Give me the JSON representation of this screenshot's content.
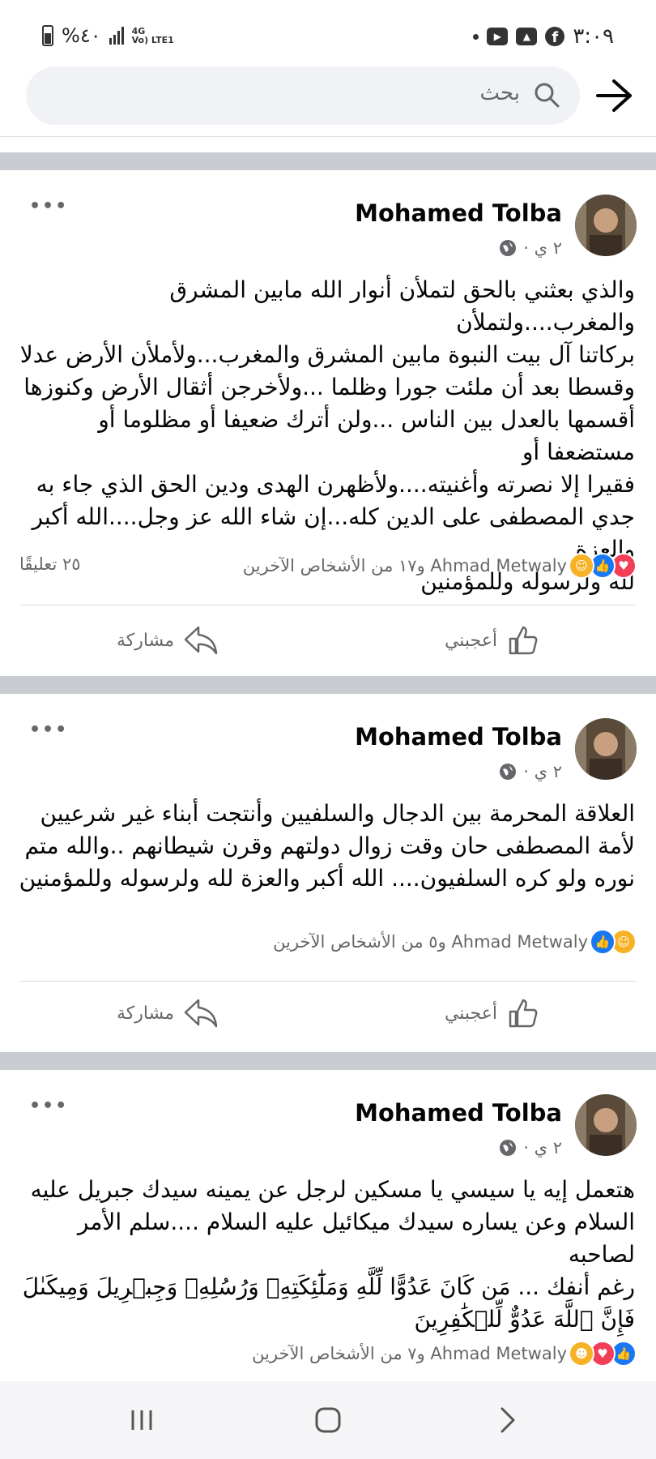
{
  "status_bar": {
    "time": "٣:٠٩",
    "battery": "%٤٠",
    "network_top": "4G",
    "network_bottom": "Vo) LTE1"
  },
  "search": {
    "placeholder": "بحث"
  },
  "posts": [
    {
      "author": "Mohamed Tolba",
      "time": "٢ ي ·",
      "text": "والذي بعثني بالحق لتملأن أنوار الله مابين المشرق والمغرب....ولتملأن\nبركاتنا آل بيت النبوة مابين المشرق والمغرب...ولأملأن الأرض عدلا\nوقسطا بعد أن ملئت جورا وظلما ...ولأخرجن أثقال الأرض وكنوزها\nأقسمها بالعدل بين الناس ...ولن أترك ضعيفا أو مظلوما أو مستضعفا أو\nفقيرا إلا نصرته وأغنيته....ولأظهرن الهدى ودين الحق الذي جاء به\nجدي المصطفى على الدين كله...إن شاء الله عز وجل....الله أكبر والعزة\nلله ولرسوله وللمؤمنين",
      "reactions_text": "Ahmad Metwaly و١٧ من الأشخاص الآخرين",
      "comments": "٢٥ تعليقًا",
      "like_label": "أعجبني",
      "share_label": "مشاركة"
    },
    {
      "author": "Mohamed Tolba",
      "time": "٢ ي ·",
      "text": "العلاقة المحرمة بين الدجال والسلفيين وأنتجت أبناء غير شرعيين\nلأمة المصطفى حان وقت زوال دولتهم وقرن شيطانهم ..والله متم\nنوره ولو كره السلفيون....  الله أكبر والعزة لله ولرسوله وللمؤمنين",
      "reactions_text": "Ahmad Metwaly و٥ من الأشخاص الآخرين",
      "like_label": "أعجبني",
      "share_label": "مشاركة"
    },
    {
      "author": "Mohamed Tolba",
      "time": "٢ ي ·",
      "text": "هتعمل إيه يا سيسي يا مسكين لرجل عن يمينه سيدك جبريل عليه\nالسلام وعن يساره سيدك ميكائيل عليه السلام ....سلم الأمر لصاحبه\nرغم أنفك ... مَن كَانَ عَدُوًّا لِّلَّهِ وَمَلَٰٓئِكَتِهِۦ وَرُسُلِهِۦ وَجِبۡرِيلَ وَمِيكَىٰلَ\nفَإِنَّ ٱللَّهَ عَدُوٌّ لِّلۡكَٰفِرِينَ",
      "reactions_text": "Ahmad Metwaly و٧ من الأشخاص الآخرين"
    }
  ],
  "icons": [
    "battery-icon",
    "signal-icon",
    "youtube-icon",
    "gallery-icon",
    "facebook-icon",
    "search-icon",
    "back-arrow-icon",
    "globe-icon",
    "more-icon",
    "like-icon",
    "share-icon",
    "love-reaction-icon",
    "like-reaction-icon",
    "care-reaction-icon",
    "haha-reaction-icon",
    "recents-icon",
    "home-icon",
    "back-icon"
  ],
  "colors": {
    "accent": "#1877f2",
    "love": "#f33e58",
    "secondary_text": "#65676b",
    "separator": "#c9ccd1"
  }
}
